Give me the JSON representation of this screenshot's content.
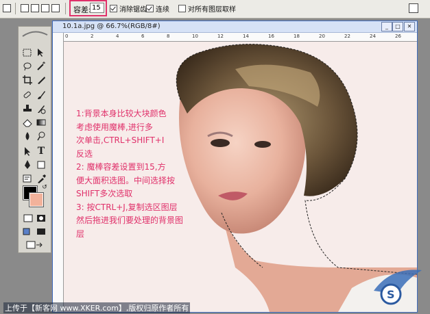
{
  "options_bar": {
    "tolerance_label": "容差:",
    "tolerance_value": "15",
    "anti_alias_label": "消除锯齿",
    "anti_alias_checked": true,
    "contiguous_label": "连续",
    "contiguous_checked": true,
    "sample_all_layers_label": "对所有图层取样",
    "sample_all_layers_checked": false
  },
  "document": {
    "title": "10.1a.jpg @ 66.7%(RGB/8#)"
  },
  "ruler_top_marks": [
    "0",
    "2",
    "4",
    "6",
    "8",
    "10",
    "12",
    "14",
    "16",
    "18",
    "20",
    "22",
    "24",
    "26"
  ],
  "instructions": [
    "1:背景本身比较大块颜色",
    "考虑使用魔棒,进行多",
    "次单击,CTRL+SHIFT+I",
    "反选",
    "2: 魔棒容差设置到15,方",
    "便大面积选图。中间选择按",
    "SHIFT多次选取",
    "3: 按CTRL+J,复制选区图层",
    "然后拖进我们要处理的背景图",
    "层"
  ],
  "colors": {
    "foreground": "#000000",
    "background": "#f2b29b",
    "annotation": "#e0306a"
  },
  "watermark": "上传于【新客网 www.XKER.com】,版权归原作者所有"
}
